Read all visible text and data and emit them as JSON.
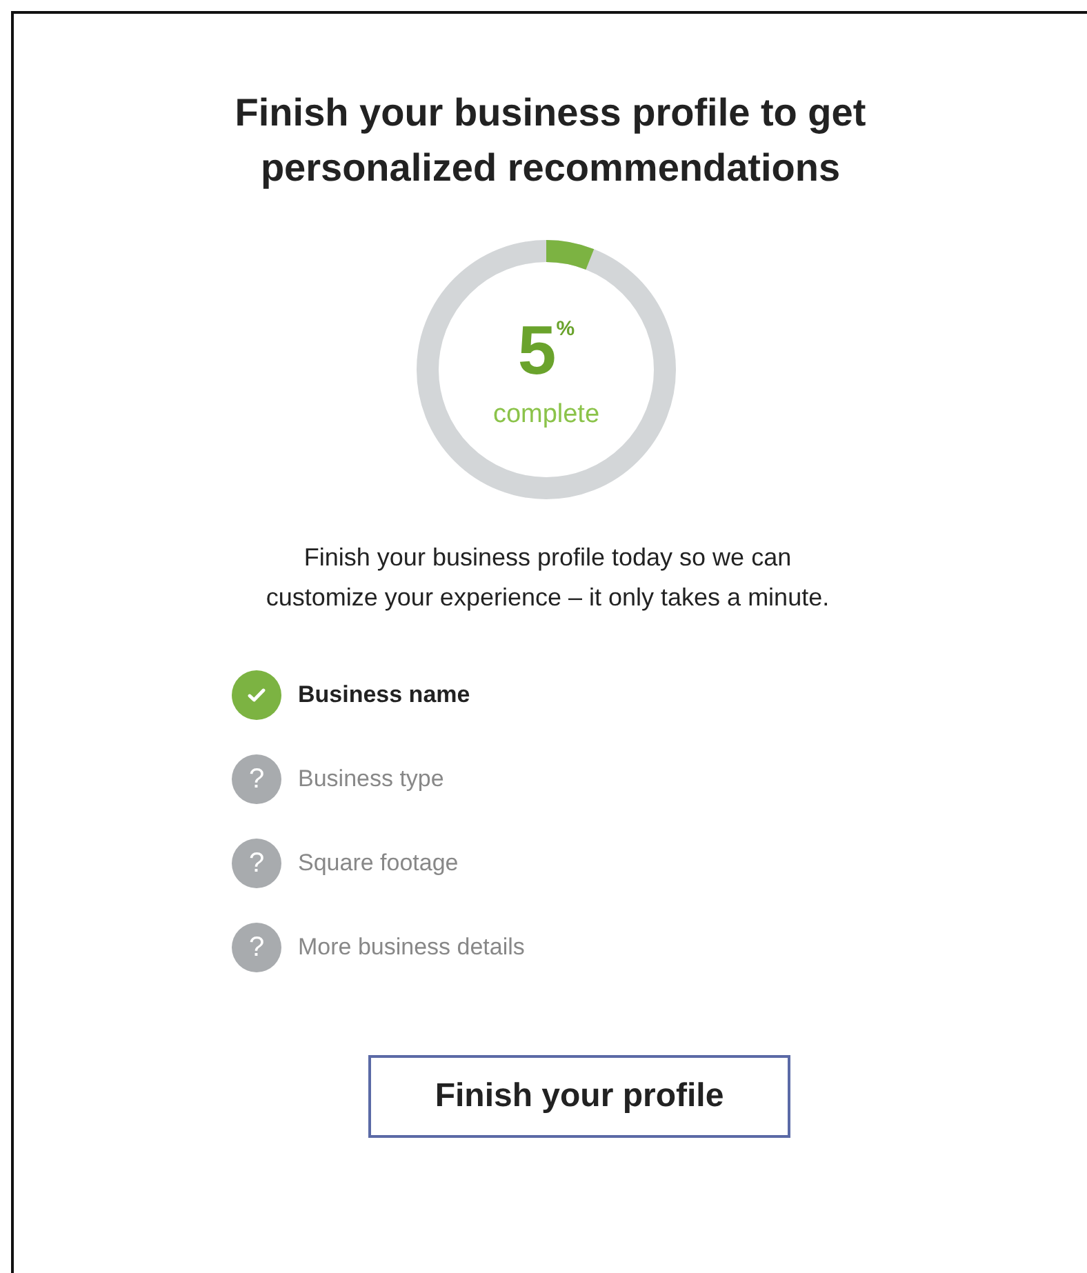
{
  "title": "Finish your business profile to get personalized recommendations",
  "progress": {
    "value": "5",
    "unit": "%",
    "caption": "complete"
  },
  "description_lines": [
    "Finish your business profile today so we can",
    "customize your experience – it only takes a minute."
  ],
  "checklist": [
    {
      "label": "Business name",
      "checked": true
    },
    {
      "label": "Business type",
      "checked": false,
      "mark": "?"
    },
    {
      "label": "Square footage",
      "checked": false,
      "mark": "?"
    },
    {
      "label": "More business details",
      "checked": false,
      "mark": "?"
    }
  ],
  "button": "Finish your profile"
}
